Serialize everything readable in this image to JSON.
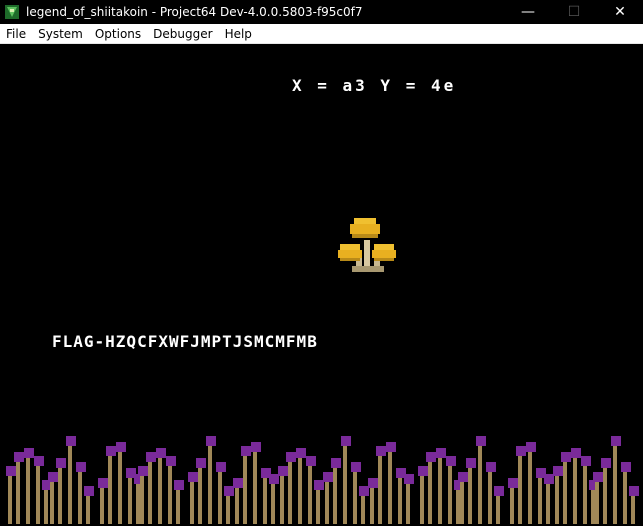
{
  "window": {
    "title": "legend_of_shiitakoin - Project64 Dev-4.0.0.5803-f95c0f7",
    "controls": {
      "minimize": "—",
      "maximize": "☐",
      "close": "✕"
    }
  },
  "menu": {
    "items": [
      "File",
      "System",
      "Options",
      "Debugger",
      "Help"
    ]
  },
  "game": {
    "coords_text": "X = a3 Y = 4e",
    "flag_text": "FLAG-HZQCFXWFJMPTJSMCMFMB"
  },
  "colors": {
    "mushroom_cap": "#e8b020",
    "mushroom_stem": "#d8c8a0",
    "weed_stem": "#a08858",
    "weed_bulb": "#7a2a9a"
  }
}
